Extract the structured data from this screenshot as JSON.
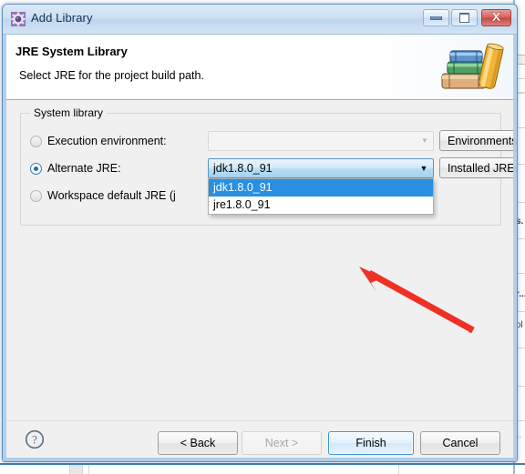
{
  "window": {
    "title": "Add Library",
    "icon": "gear-icon",
    "controls": {
      "minimize": "minimize-icon",
      "maximize": "maximize-icon",
      "close": "close-icon"
    }
  },
  "header": {
    "title": "JRE System Library",
    "subtitle": "Select JRE for the project build path.",
    "icon": "books-stack-icon"
  },
  "group": {
    "legend": "System library",
    "options": [
      {
        "id": "execution-environment",
        "label": "Execution environment:",
        "selected": false
      },
      {
        "id": "alternate-jre",
        "label": "Alternate JRE:",
        "selected": true
      },
      {
        "id": "workspace-default-jre",
        "label": "Workspace default JRE (j",
        "selected": false
      }
    ],
    "execution_combo": {
      "value": "",
      "placeholder": "",
      "enabled": false,
      "arrow": "chevron-down-icon"
    },
    "alternate_combo": {
      "value": "jdk1.8.0_91",
      "enabled": true,
      "expanded": true,
      "arrow": "chevron-down-icon",
      "options": [
        {
          "label": "jdk1.8.0_91",
          "selected": true
        },
        {
          "label": "jre1.8.0_91",
          "selected": false
        }
      ]
    },
    "buttons": {
      "environments": "Environments...",
      "installed_jres": "Installed JREs..."
    }
  },
  "footer": {
    "help": "help-icon",
    "back": "< Back",
    "next": "Next >",
    "finish": "Finish",
    "cancel": "Cancel"
  },
  "annotation": {
    "type": "arrow",
    "color": "#ee3124"
  },
  "colors": {
    "accent": "#2a8fe0",
    "titlebar": "#cfe0f2",
    "dialog_bg": "#f0f0f0",
    "close_button": "#c24c44",
    "annotation_red": "#ee3124"
  },
  "background": {
    "app": "eclipse-ide",
    "fragments": [
      "s.",
      "r...",
      "ol"
    ]
  }
}
